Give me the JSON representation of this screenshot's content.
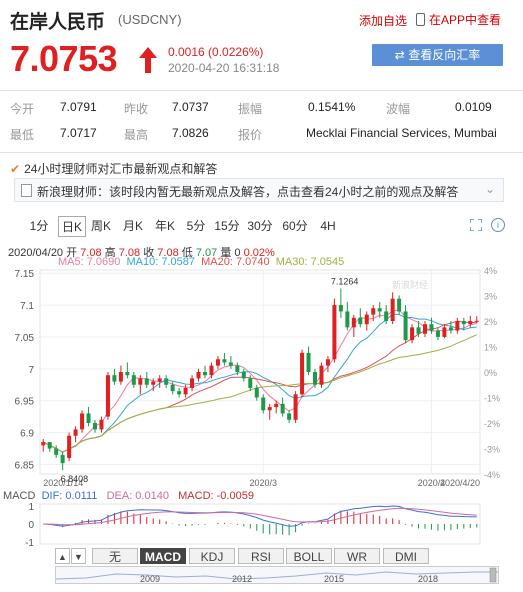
{
  "header": {
    "title": "在岸人民币",
    "code": "(USDCNY)",
    "add_fav": "添加自选",
    "app_view": "在APP中查看"
  },
  "quote": {
    "price": "7.0753",
    "change": "0.0016 (0.0226%)",
    "time": "2020-04-20 16:31:18",
    "reverse_button": "查看反向汇率"
  },
  "stats": [
    {
      "label": "今开",
      "value": "7.0791"
    },
    {
      "label": "昨收",
      "value": "7.0737"
    },
    {
      "label": "振幅",
      "value": "0.1541%"
    },
    {
      "label": "波幅",
      "value": "0.0109"
    },
    {
      "label": "最低",
      "value": "7.0717"
    },
    {
      "label": "最高",
      "value": "7.0826"
    },
    {
      "label": "报价",
      "value": "Mecklai Financial Services, Mumbai"
    }
  ],
  "analyst": {
    "headline": "24小时理财师对汇市最新观点和解答",
    "message": "新浪理财师：该时段内暂无最新观点及解答，点击查看24小时之前的观点及解答"
  },
  "tabs": [
    "1分",
    "日K",
    "周K",
    "月K",
    "年K",
    "5分",
    "15分",
    "30分",
    "60分",
    "4H"
  ],
  "active_tab": "日K",
  "ohlc": {
    "date": "2020/04/20",
    "open_label": "开",
    "open": "7.08",
    "high_label": "高",
    "high": "7.08",
    "close_label": "收",
    "close": "7.08",
    "low_label": "低",
    "low": "7.07",
    "vol_label": "量",
    "vol": "0",
    "pct": "0.02%"
  },
  "ma": {
    "ma5": "MA5: 7.0690",
    "ma10": "MA10: 7.0587",
    "ma20": "MA20: 7.0740",
    "ma30": "MA30: 7.0545"
  },
  "colors": {
    "up": "#e02020",
    "down": "#1a9a4a",
    "ma5": "#f07aa0",
    "ma10": "#2fa9d6",
    "ma20": "#e05050",
    "ma30": "#a0b040",
    "accent": "#5b8fd6"
  },
  "chart_data": {
    "type": "candlestick",
    "y_ticks": [
      "7.15",
      "7.1",
      "7.05",
      "7",
      "6.95",
      "6.9",
      "6.85"
    ],
    "y_range": [
      6.835,
      7.155
    ],
    "pct_ticks": [
      "4%",
      "3%",
      "2%",
      "1%",
      "0%",
      "-1%",
      "-2%",
      "-3%",
      "-4%"
    ],
    "x_ticks": [
      "2020/1/14",
      "2020/3",
      "2020/4",
      "2020/4/20"
    ],
    "max_label": "7.1264",
    "min_label": "6.8408",
    "watermark": "新浪财经",
    "candles": [
      [
        6.88,
        6.89,
        6.87,
        6.885
      ],
      [
        6.885,
        6.885,
        6.87,
        6.875
      ],
      [
        6.875,
        6.88,
        6.86,
        6.865
      ],
      [
        6.865,
        6.87,
        6.841,
        6.852
      ],
      [
        6.86,
        6.9,
        6.855,
        6.895
      ],
      [
        6.895,
        6.91,
        6.885,
        6.905
      ],
      [
        6.905,
        6.935,
        6.9,
        6.93
      ],
      [
        6.93,
        6.94,
        6.91,
        6.915
      ],
      [
        6.915,
        6.92,
        6.9,
        6.905
      ],
      [
        6.905,
        6.925,
        6.9,
        6.92
      ],
      [
        6.925,
        6.995,
        6.92,
        6.99
      ],
      [
        6.99,
        7.0,
        6.975,
        6.98
      ],
      [
        6.98,
        7.005,
        6.975,
        6.995
      ],
      [
        6.995,
        7.01,
        6.985,
        6.99
      ],
      [
        6.99,
        6.995,
        6.97,
        6.975
      ],
      [
        6.975,
        6.99,
        6.96,
        6.985
      ],
      [
        6.985,
        6.995,
        6.97,
        6.975
      ],
      [
        6.975,
        6.985,
        6.965,
        6.98
      ],
      [
        6.98,
        6.99,
        6.97,
        6.985
      ],
      [
        6.985,
        6.99,
        6.97,
        6.975
      ],
      [
        6.975,
        6.98,
        6.96,
        6.965
      ],
      [
        6.965,
        6.97,
        6.955,
        6.96
      ],
      [
        6.96,
        6.975,
        6.955,
        6.97
      ],
      [
        6.97,
        6.99,
        6.965,
        6.985
      ],
      [
        6.985,
        7.0,
        6.98,
        6.995
      ],
      [
        6.995,
        7.005,
        6.985,
        6.99
      ],
      [
        6.99,
        7.01,
        6.985,
        7.005
      ],
      [
        7.005,
        7.02,
        7.0,
        7.015
      ],
      [
        7.015,
        7.025,
        7.005,
        7.01
      ],
      [
        7.01,
        7.02,
        7.0,
        7.005
      ],
      [
        7.005,
        7.01,
        6.99,
        6.995
      ],
      [
        6.995,
        7.0,
        6.98,
        6.985
      ],
      [
        6.985,
        6.99,
        6.965,
        6.97
      ],
      [
        6.97,
        6.975,
        6.95,
        6.955
      ],
      [
        6.955,
        6.96,
        6.93,
        6.935
      ],
      [
        6.935,
        6.945,
        6.92,
        6.94
      ],
      [
        6.94,
        6.95,
        6.93,
        6.945
      ],
      [
        6.945,
        6.955,
        6.925,
        6.93
      ],
      [
        6.93,
        6.935,
        6.915,
        6.92
      ],
      [
        6.92,
        6.965,
        6.915,
        6.96
      ],
      [
        6.96,
        7.03,
        6.955,
        7.025
      ],
      [
        7.025,
        7.035,
        6.99,
        6.995
      ],
      [
        6.995,
        7.0,
        6.97,
        6.975
      ],
      [
        6.975,
        7.01,
        6.97,
        7.005
      ],
      [
        7.005,
        7.02,
        6.995,
        7.015
      ],
      [
        7.015,
        7.11,
        7.01,
        7.1
      ],
      [
        7.1,
        7.126,
        7.08,
        7.09
      ],
      [
        7.09,
        7.105,
        7.06,
        7.065
      ],
      [
        7.065,
        7.085,
        7.05,
        7.08
      ],
      [
        7.08,
        7.095,
        7.065,
        7.07
      ],
      [
        7.07,
        7.09,
        7.06,
        7.085
      ],
      [
        7.085,
        7.1,
        7.075,
        7.095
      ],
      [
        7.095,
        7.105,
        7.08,
        7.09
      ],
      [
        7.09,
        7.1,
        7.07,
        7.075
      ],
      [
        7.075,
        7.12,
        7.07,
        7.11
      ],
      [
        7.11,
        7.115,
        7.085,
        7.09
      ],
      [
        7.09,
        7.1,
        7.04,
        7.045
      ],
      [
        7.045,
        7.07,
        7.04,
        7.065
      ],
      [
        7.065,
        7.075,
        7.05,
        7.055
      ],
      [
        7.055,
        7.075,
        7.05,
        7.07
      ],
      [
        7.07,
        7.08,
        7.055,
        7.06
      ],
      [
        7.06,
        7.065,
        7.045,
        7.05
      ],
      [
        7.05,
        7.07,
        7.048,
        7.065
      ],
      [
        7.065,
        7.075,
        7.055,
        7.06
      ],
      [
        7.06,
        7.08,
        7.055,
        7.075
      ],
      [
        7.075,
        7.08,
        7.06,
        7.07
      ],
      [
        7.07,
        7.083,
        7.065,
        7.075
      ],
      [
        7.0737,
        7.0826,
        7.0717,
        7.0753
      ]
    ],
    "macd": {
      "y_ticks": [
        "1",
        "0",
        "-1"
      ],
      "dif": "DIF: 0.0111",
      "dea": "DEA: 0.0140",
      "macd": "MACD: -0.0059"
    }
  },
  "indicator_buttons": [
    "无",
    "MACD",
    "KDJ",
    "RSI",
    "BOLL",
    "WR",
    "DMI"
  ],
  "active_indicator": "MACD",
  "navigator": {
    "years": [
      "2009",
      "2012",
      "2015",
      "2018"
    ]
  }
}
